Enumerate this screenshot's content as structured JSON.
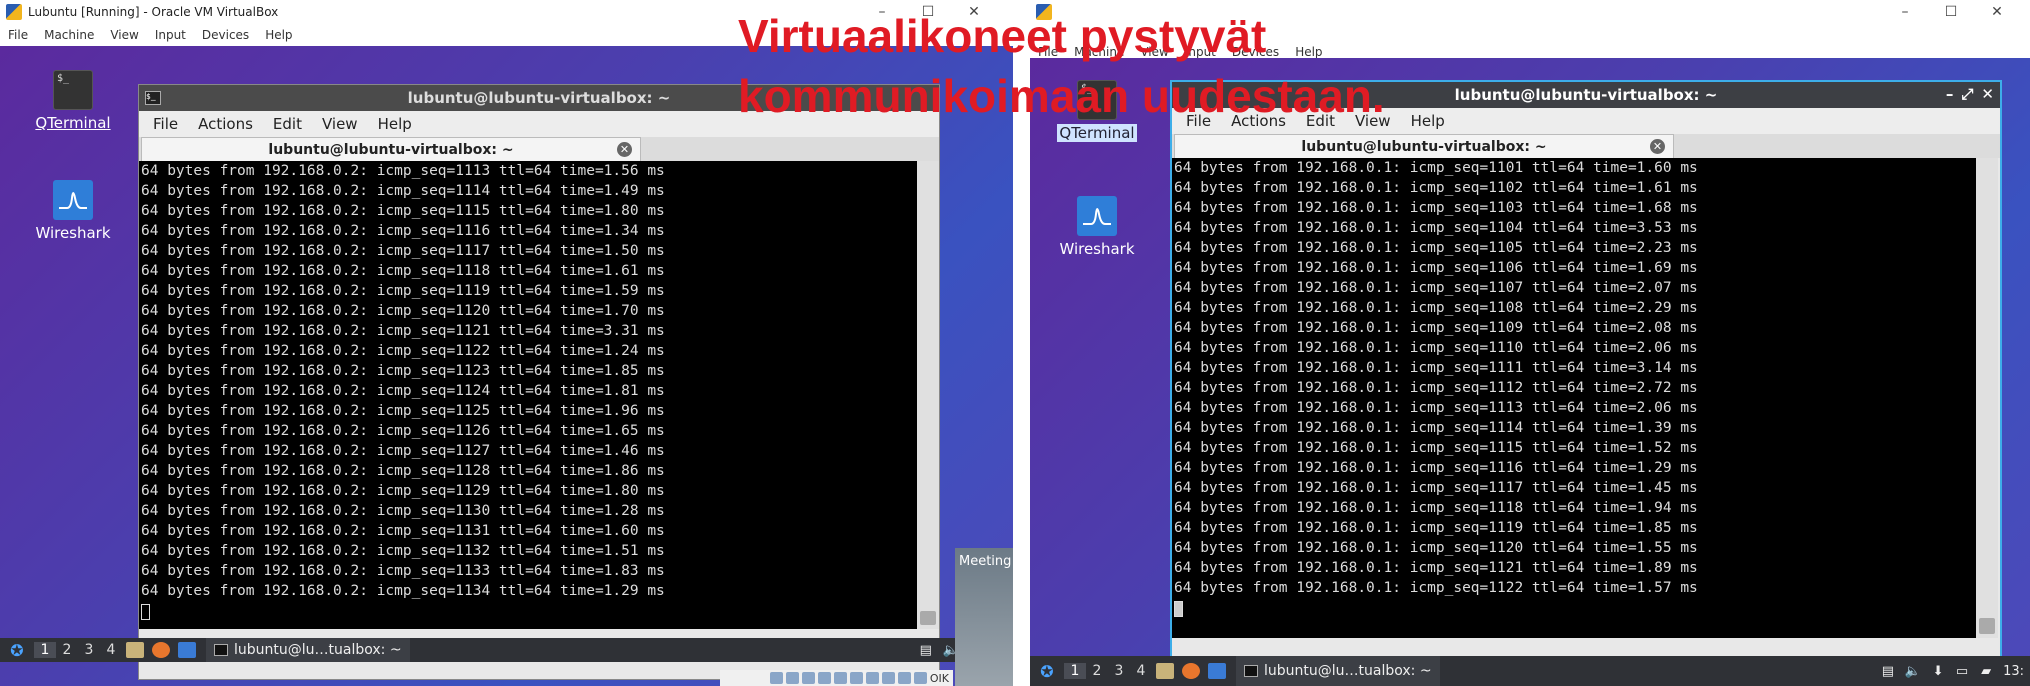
{
  "left": {
    "host_title": "Lubuntu [Running] - Oracle VM VirtualBox",
    "host_menu": [
      "File",
      "Machine",
      "View",
      "Input",
      "Devices",
      "Help"
    ],
    "host_controls": [
      "–",
      "☐",
      "✕"
    ],
    "desktop_icons": [
      {
        "label": "QTerminal",
        "icon": "terminal-icon"
      },
      {
        "label": "Wireshark",
        "icon": "wireshark-icon"
      }
    ],
    "terminal": {
      "title": "lubuntu@lubuntu-virtualbox: ~",
      "menu": [
        "File",
        "Actions",
        "Edit",
        "View",
        "Help"
      ],
      "tab_label": "lubuntu@lubuntu-virtualbox: ~",
      "lines": [
        "64 bytes from 192.168.0.2: icmp_seq=1113 ttl=64 time=1.56 ms",
        "64 bytes from 192.168.0.2: icmp_seq=1114 ttl=64 time=1.49 ms",
        "64 bytes from 192.168.0.2: icmp_seq=1115 ttl=64 time=1.80 ms",
        "64 bytes from 192.168.0.2: icmp_seq=1116 ttl=64 time=1.34 ms",
        "64 bytes from 192.168.0.2: icmp_seq=1117 ttl=64 time=1.50 ms",
        "64 bytes from 192.168.0.2: icmp_seq=1118 ttl=64 time=1.61 ms",
        "64 bytes from 192.168.0.2: icmp_seq=1119 ttl=64 time=1.59 ms",
        "64 bytes from 192.168.0.2: icmp_seq=1120 ttl=64 time=1.70 ms",
        "64 bytes from 192.168.0.2: icmp_seq=1121 ttl=64 time=3.31 ms",
        "64 bytes from 192.168.0.2: icmp_seq=1122 ttl=64 time=1.24 ms",
        "64 bytes from 192.168.0.2: icmp_seq=1123 ttl=64 time=1.85 ms",
        "64 bytes from 192.168.0.2: icmp_seq=1124 ttl=64 time=1.81 ms",
        "64 bytes from 192.168.0.2: icmp_seq=1125 ttl=64 time=1.96 ms",
        "64 bytes from 192.168.0.2: icmp_seq=1126 ttl=64 time=1.65 ms",
        "64 bytes from 192.168.0.2: icmp_seq=1127 ttl=64 time=1.46 ms",
        "64 bytes from 192.168.0.2: icmp_seq=1128 ttl=64 time=1.86 ms",
        "64 bytes from 192.168.0.2: icmp_seq=1129 ttl=64 time=1.80 ms",
        "64 bytes from 192.168.0.2: icmp_seq=1130 ttl=64 time=1.28 ms",
        "64 bytes from 192.168.0.2: icmp_seq=1131 ttl=64 time=1.60 ms",
        "64 bytes from 192.168.0.2: icmp_seq=1132 ttl=64 time=1.51 ms",
        "64 bytes from 192.168.0.2: icmp_seq=1133 ttl=64 time=1.83 ms",
        "64 bytes from 192.168.0.2: icmp_seq=1134 ttl=64 time=1.29 ms"
      ]
    },
    "taskbar": {
      "workspaces": [
        "1",
        "2",
        "3",
        "4"
      ],
      "active_workspace": "1",
      "task_label": "lubuntu@lu…tualbox: ~"
    },
    "meeting_label": "Meeting",
    "statusbar_text": "OIK"
  },
  "right": {
    "desktop_icons": [
      {
        "label": "QTerminal",
        "icon": "terminal-icon"
      },
      {
        "label": "Wireshark",
        "icon": "wireshark-icon"
      }
    ],
    "host_menu": [
      "File",
      "Machine",
      "View",
      "Input",
      "Devices",
      "Help"
    ],
    "terminal": {
      "title": "lubuntu@lubuntu-virtualbox: ~",
      "menu": [
        "File",
        "Actions",
        "Edit",
        "View",
        "Help"
      ],
      "tab_label": "lubuntu@lubuntu-virtualbox: ~",
      "controls": [
        "–",
        "⤢",
        "✕"
      ],
      "lines": [
        "64 bytes from 192.168.0.1: icmp_seq=1101 ttl=64 time=1.60 ms",
        "64 bytes from 192.168.0.1: icmp_seq=1102 ttl=64 time=1.61 ms",
        "64 bytes from 192.168.0.1: icmp_seq=1103 ttl=64 time=1.68 ms",
        "64 bytes from 192.168.0.1: icmp_seq=1104 ttl=64 time=3.53 ms",
        "64 bytes from 192.168.0.1: icmp_seq=1105 ttl=64 time=2.23 ms",
        "64 bytes from 192.168.0.1: icmp_seq=1106 ttl=64 time=1.69 ms",
        "64 bytes from 192.168.0.1: icmp_seq=1107 ttl=64 time=2.07 ms",
        "64 bytes from 192.168.0.1: icmp_seq=1108 ttl=64 time=2.29 ms",
        "64 bytes from 192.168.0.1: icmp_seq=1109 ttl=64 time=2.08 ms",
        "64 bytes from 192.168.0.1: icmp_seq=1110 ttl=64 time=2.06 ms",
        "64 bytes from 192.168.0.1: icmp_seq=1111 ttl=64 time=3.14 ms",
        "64 bytes from 192.168.0.1: icmp_seq=1112 ttl=64 time=2.72 ms",
        "64 bytes from 192.168.0.1: icmp_seq=1113 ttl=64 time=2.06 ms",
        "64 bytes from 192.168.0.1: icmp_seq=1114 ttl=64 time=1.39 ms",
        "64 bytes from 192.168.0.1: icmp_seq=1115 ttl=64 time=1.52 ms",
        "64 bytes from 192.168.0.1: icmp_seq=1116 ttl=64 time=1.29 ms",
        "64 bytes from 192.168.0.1: icmp_seq=1117 ttl=64 time=1.45 ms",
        "64 bytes from 192.168.0.1: icmp_seq=1118 ttl=64 time=1.94 ms",
        "64 bytes from 192.168.0.1: icmp_seq=1119 ttl=64 time=1.85 ms",
        "64 bytes from 192.168.0.1: icmp_seq=1120 ttl=64 time=1.55 ms",
        "64 bytes from 192.168.0.1: icmp_seq=1121 ttl=64 time=1.89 ms",
        "64 bytes from 192.168.0.1: icmp_seq=1122 ttl=64 time=1.57 ms"
      ]
    },
    "taskbar": {
      "workspaces": [
        "1",
        "2",
        "3",
        "4"
      ],
      "active_workspace": "1",
      "task_label": "lubuntu@lu…tualbox: ~",
      "clock": "13:"
    }
  },
  "overlay_caption": [
    "Virtuaalikoneet pystyvät",
    "kommunikoimaan uudestaan."
  ],
  "colors": {
    "caption": "#e01b24",
    "desktop_gradient_start": "#5b2a9e",
    "desktop_gradient_end": "#3a52c0",
    "terminal_bg": "#000000",
    "terminal_fg": "#dcdcdc",
    "active_border": "#3daee9"
  }
}
